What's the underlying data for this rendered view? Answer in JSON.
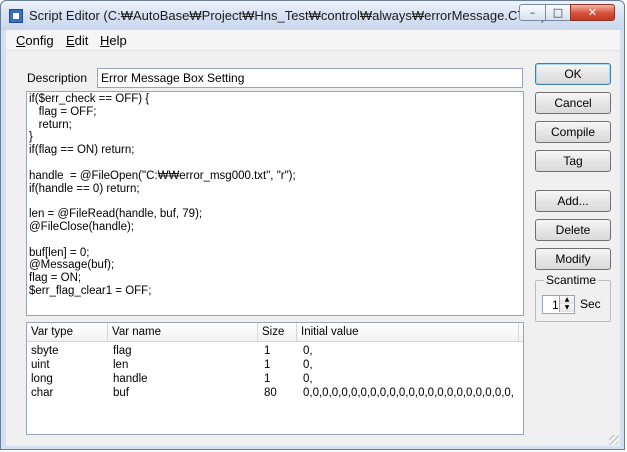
{
  "window": {
    "title": "Script Editor (C:₩AutoBase₩Project₩Hns_Test₩control₩always₩errorMessage.CTLX)"
  },
  "title_buttons": {
    "minimize": "–",
    "maximize": "□",
    "close": "✕"
  },
  "menu": [
    {
      "label": "Config",
      "accel": "C",
      "rest": "onfig"
    },
    {
      "label": "Edit",
      "accel": "E",
      "rest": "dit"
    },
    {
      "label": "Help",
      "accel": "H",
      "rest": "elp"
    }
  ],
  "description": {
    "label": "Description",
    "value": "Error Message Box Setting"
  },
  "code": "if($err_check == OFF) {\n   flag = OFF;\n   return;\n}\nif(flag == ON) return;\n\nhandle  = @FileOpen(\"C:₩₩error_msg000.txt\", \"r\");\nif(handle == 0) return;\n\nlen = @FileRead(handle, buf, 79);\n@FileClose(handle);\n\nbuf[len] = 0;\n@Message(buf);\nflag = ON;\n$err_flag_clear1 = OFF;",
  "buttons": {
    "ok": "OK",
    "cancel": "Cancel",
    "compile": "Compile",
    "tag": "Tag",
    "add": "Add...",
    "delete": "Delete",
    "modify": "Modify"
  },
  "scantime": {
    "title": "Scantime",
    "value": "1",
    "unit": "Sec"
  },
  "vars": {
    "columns": [
      "Var type",
      "Var name",
      "Size",
      "Initial value"
    ],
    "rows": [
      [
        "sbyte",
        "flag",
        "1",
        "0,"
      ],
      [
        "uint",
        "len",
        "1",
        "0,"
      ],
      [
        "long",
        "handle",
        "1",
        "0,"
      ],
      [
        "char",
        "buf",
        "80",
        "0,0,0,0,0,0,0,0,0,0,0,0,0,0,0,0,0,0,0,0,0,0,0,0..."
      ]
    ]
  }
}
